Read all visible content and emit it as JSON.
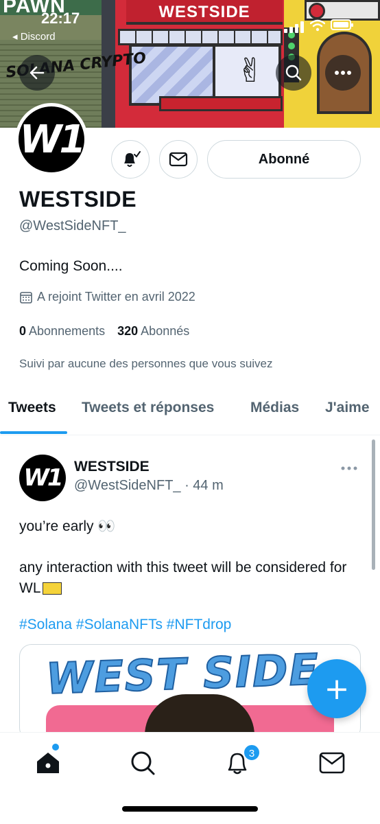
{
  "status_bar": {
    "time": "22:17",
    "back_app": "◂ Discord"
  },
  "banner": {
    "sign_left": "PAWN",
    "sign_main": "WESTSIDE",
    "graffiti": "SOLANA CRYPTO"
  },
  "profile": {
    "avatar_logo": "W1",
    "follow_button_label": "Abonné",
    "name": "WESTSIDE",
    "handle": "@WestSideNFT_",
    "bio": "Coming Soon....",
    "joined": "A rejoint Twitter en avril 2022",
    "following_count": "0",
    "following_label": "Abonnements",
    "followers_count": "320",
    "followers_label": "Abonnés",
    "followed_by": "Suivi par aucune des personnes que vous suivez"
  },
  "tabs": [
    {
      "label": "Tweets",
      "active": true
    },
    {
      "label": "Tweets et réponses",
      "active": false
    },
    {
      "label": "Médias",
      "active": false
    },
    {
      "label": "J'aime",
      "active": false
    }
  ],
  "tweet": {
    "author_name": "WESTSIDE",
    "author_handle": "@WestSideNFT_ · 44 m",
    "text_line1": "you’re early 👀",
    "text_line2": "any interaction with this tweet will be considered for WL",
    "hashtags": "#Solana #SolanaNFTs #NFTdrop",
    "media_title": "WEST SIDE"
  },
  "fab": {
    "icon": "plus-icon",
    "label": "+"
  },
  "bottom_nav": {
    "items": [
      "home-icon",
      "search-icon",
      "bell-icon",
      "mail-icon"
    ],
    "notifications_badge": "3"
  },
  "colors": {
    "accent": "#1d9bf0",
    "text_primary": "#0f1419",
    "text_secondary": "#536471"
  }
}
